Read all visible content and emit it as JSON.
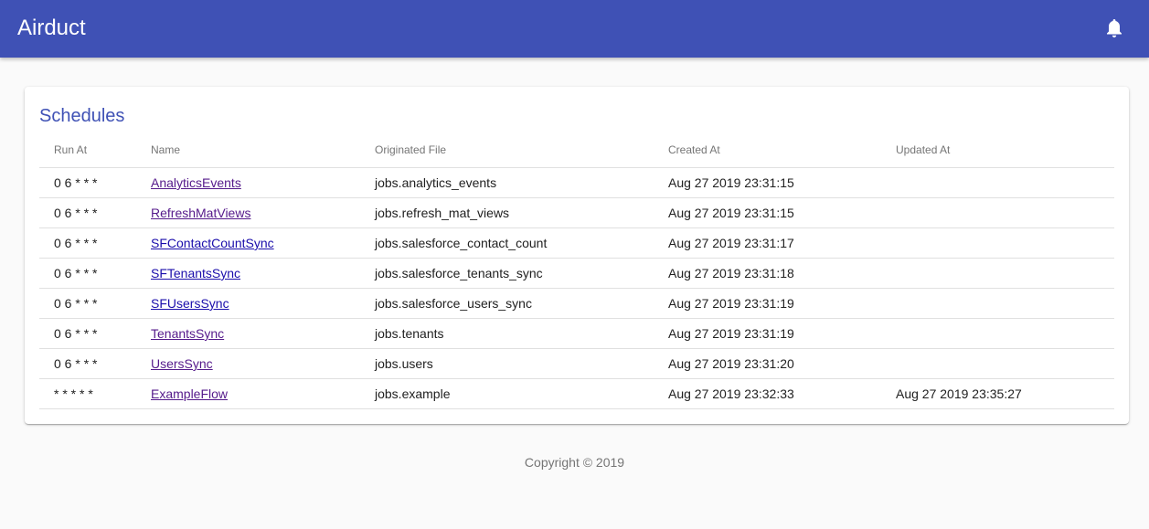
{
  "app": {
    "title": "Airduct",
    "notifications_icon": "bell-icon"
  },
  "schedules": {
    "title": "Schedules",
    "columns": [
      "Run At",
      "Name",
      "Originated File",
      "Created At",
      "Updated At"
    ],
    "rows": [
      {
        "run_at": "0 6 * * *",
        "name": "AnalyticsEvents",
        "file": "jobs.analytics_events",
        "created_at": "Aug 27 2019 23:31:15",
        "updated_at": ""
      },
      {
        "run_at": "0 6 * * *",
        "name": "RefreshMatViews",
        "file": "jobs.refresh_mat_views",
        "created_at": "Aug 27 2019 23:31:15",
        "updated_at": ""
      },
      {
        "run_at": "0 6 * * *",
        "name": "SFContactCountSync",
        "file": "jobs.salesforce_contact_count",
        "created_at": "Aug 27 2019 23:31:17",
        "updated_at": ""
      },
      {
        "run_at": "0 6 * * *",
        "name": "SFTenantsSync",
        "file": "jobs.salesforce_tenants_sync",
        "created_at": "Aug 27 2019 23:31:18",
        "updated_at": ""
      },
      {
        "run_at": "0 6 * * *",
        "name": "SFUsersSync",
        "file": "jobs.salesforce_users_sync",
        "created_at": "Aug 27 2019 23:31:19",
        "updated_at": ""
      },
      {
        "run_at": "0 6 * * *",
        "name": "TenantsSync",
        "file": "jobs.tenants",
        "created_at": "Aug 27 2019 23:31:19",
        "updated_at": ""
      },
      {
        "run_at": "0 6 * * *",
        "name": "UsersSync",
        "file": "jobs.users",
        "created_at": "Aug 27 2019 23:31:20",
        "updated_at": ""
      },
      {
        "run_at": "* * * * *",
        "name": "ExampleFlow",
        "file": "jobs.example",
        "created_at": "Aug 27 2019 23:32:33",
        "updated_at": "Aug 27 2019 23:35:27"
      }
    ]
  },
  "footer": {
    "copyright": "Copyright © 2019"
  },
  "colors": {
    "primary": "#3f51b5",
    "link_visited": "#551a8b",
    "link_unvisited": "#1a0dab"
  }
}
